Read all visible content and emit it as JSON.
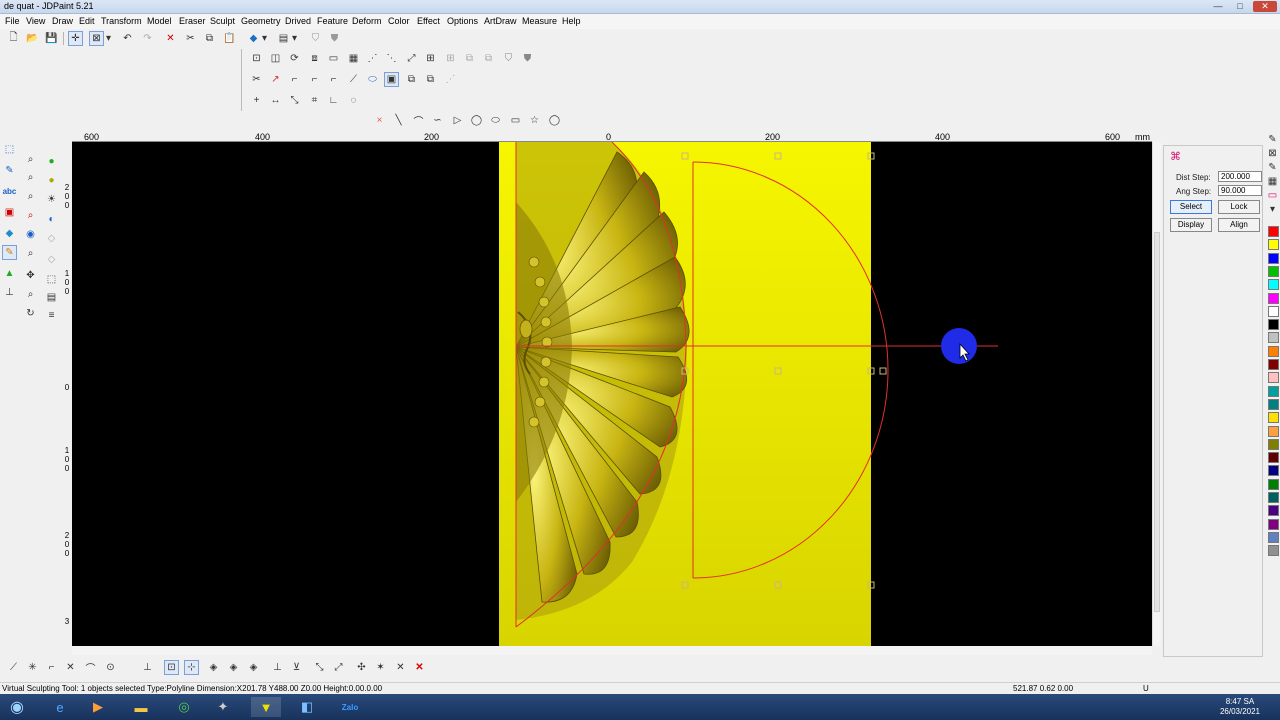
{
  "window": {
    "title": "de quat - JDPaint 5.21",
    "controls": [
      "—",
      "□",
      "✕"
    ]
  },
  "menu": [
    "File",
    "View",
    "Draw",
    "Edit",
    "Transform",
    "Model",
    "Eraser",
    "Sculpt",
    "Geometry",
    "Drived",
    "Feature",
    "Deform",
    "Color",
    "Effect",
    "Options",
    "ArtDraw",
    "Measure",
    "Help"
  ],
  "ruler": {
    "top_labels": [
      "600",
      "400",
      "200",
      "0",
      "200",
      "400",
      "600"
    ],
    "unit": "mm",
    "left_labels": [
      "2",
      "0",
      "0",
      "1",
      "0",
      "0",
      "0",
      "1",
      "0",
      "0",
      "2",
      "0",
      "0",
      "3"
    ]
  },
  "panel": {
    "dist_step_label": "Dist Step:",
    "dist_step_value": "200.000",
    "ang_step_label": "Ang Step:",
    "ang_step_value": "90.000",
    "buttons": [
      "Select",
      "Lock",
      "Display",
      "Align"
    ]
  },
  "palette": [
    "#ff0000",
    "#ffff00",
    "#0000ff",
    "#00c000",
    "#00ffff",
    "#ff00ff",
    "#ffffff",
    "#000000",
    "#c0c0c0",
    "#ff8000",
    "#800000",
    "#ffc0c0",
    "#00a0a0",
    "#008080",
    "#ffe000",
    "#ffa040",
    "#808000",
    "#600000",
    "#000080",
    "#008000",
    "#006060",
    "#4b0082",
    "#800080",
    "#6080c0",
    "#909090"
  ],
  "status": {
    "message": "Virtual Sculpting Tool: 1 objects selected Type:Polyline Dimension:X201.78 Y488.00 Z0.00 Height:0.00.0.00",
    "coords": "521.87 0.62 0.00",
    "indicator": "U"
  },
  "taskbar": {
    "time": "8:47 SA",
    "date": "26/03/2021",
    "zalo_label": "Zalo"
  },
  "colors": {
    "background": "#000000",
    "relief": "#e4e400",
    "curve": "#e03030",
    "cursor_marker": "#1f2be6"
  }
}
